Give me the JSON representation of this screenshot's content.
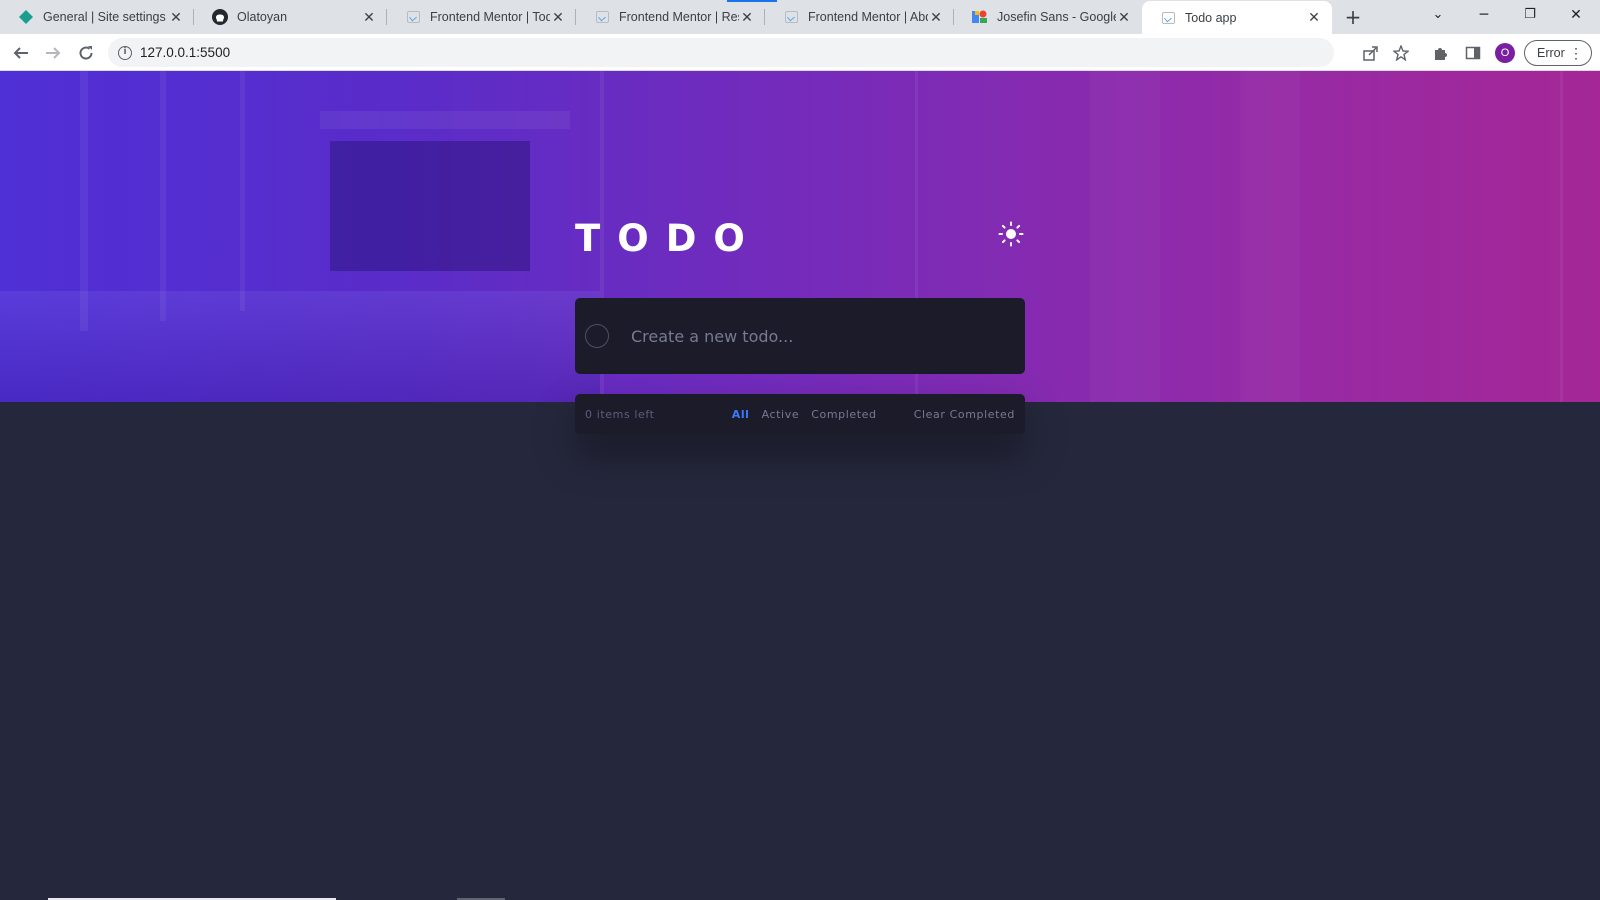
{
  "browser": {
    "tabs": [
      {
        "title": "General | Site settings",
        "icon": "diamond-icon"
      },
      {
        "title": "Olatoyan",
        "icon": "github-icon"
      },
      {
        "title": "Frontend Mentor | Todo",
        "icon": "frame-icon"
      },
      {
        "title": "Frontend Mentor | Resp",
        "icon": "frame-icon"
      },
      {
        "title": "Frontend Mentor | Abd",
        "icon": "frame-icon"
      },
      {
        "title": "Josefin Sans - Google F",
        "icon": "google-fonts-icon"
      },
      {
        "title": "Todo app",
        "icon": "frame-icon",
        "active": true
      }
    ],
    "url": "127.0.0.1:5500",
    "profile_initial": "O",
    "error_label": "Error"
  },
  "app": {
    "logo": "TODO",
    "new_todo_placeholder": "Create a new todo...",
    "items_left": "0 items left",
    "filters": [
      "All",
      "Active",
      "Completed"
    ],
    "selected_filter": "All",
    "clear_completed": "Clear Completed",
    "theme_toggle_icon": "sun-icon"
  },
  "colors": {
    "accent": "#3a7bfd",
    "background": "#25273c",
    "card": "#1b1b29"
  }
}
